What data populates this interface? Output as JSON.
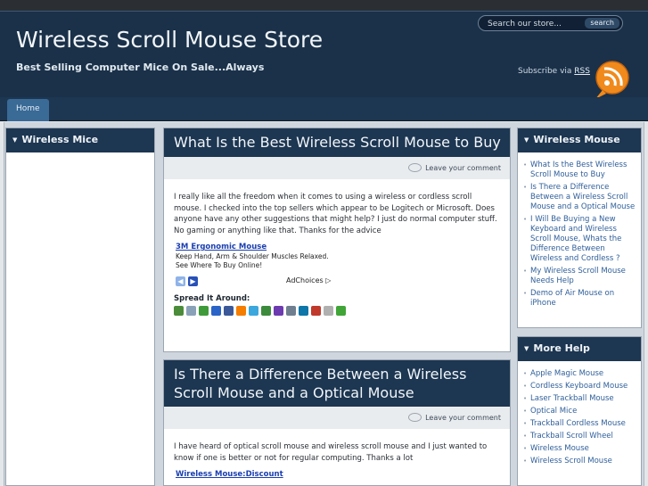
{
  "header": {
    "site_title": "Wireless Scroll Mouse Store",
    "tagline": "Best Selling Computer Mice On Sale...Always",
    "search_placeholder": "Search our store...",
    "search_button": "search",
    "subscribe_text": "Subscribe via",
    "subscribe_link": "RSS",
    "rss_icon": "rss-feed-icon"
  },
  "nav": {
    "items": [
      {
        "label": "Home"
      }
    ]
  },
  "left_sidebar": {
    "title": "Wireless Mice"
  },
  "posts": [
    {
      "title": "What Is the Best Wireless Scroll Mouse to Buy",
      "comment_link": "Leave your comment",
      "body": "I really like all the freedom when it comes to using a wireless or cordless scroll mouse. I checked into the top sellers which appear to be Logitech or Microsoft. Does anyone have any other suggestions that might help? I just do normal computer stuff. No gaming or anything like that. Thanks for the advice",
      "ad": {
        "link": "3M Ergonomic Mouse",
        "line1": "Keep Hand, Arm & Shoulder Muscles Relaxed.",
        "line2": "See Where To Buy Online!",
        "adchoices": "AdChoices ▷"
      },
      "spread_label": "Spread It Around:"
    },
    {
      "title": "Is There a Difference Between a Wireless Scroll Mouse and a Optical Mouse",
      "comment_link": "Leave your comment",
      "body": "I have heard of optical scroll mouse and wireless scroll mouse and I just wanted to know if one is better or not for regular computing. Thanks a lot",
      "ad": {
        "link": "Wireless Mouse:Discount"
      }
    }
  ],
  "right_sidebar": {
    "widgets": [
      {
        "title": "Wireless Mouse",
        "items": [
          "What Is the Best Wireless Scroll Mouse to Buy",
          "Is There a Difference Between a Wireless Scroll Mouse and a Optical Mouse",
          "I Will Be Buying a New Keyboard and Wireless Scroll Mouse, Whats the Difference Between Wireless and Cordless ?",
          "My Wireless Scroll Mouse Needs Help",
          "Demo of Air Mouse on iPhone"
        ]
      },
      {
        "title": "More Help",
        "items": [
          "Apple Magic Mouse",
          "Cordless Keyboard Mouse",
          "Laser Trackball Mouse",
          "Optical Mice",
          "Trackball Cordless Mouse",
          "Trackball Scroll Wheel",
          "Wireless Mouse",
          "Wireless Scroll Mouse"
        ]
      }
    ]
  },
  "share_icons": [
    {
      "name": "print-icon",
      "color": "#4b8c3a"
    },
    {
      "name": "digg-icon",
      "color": "#8aa2b8"
    },
    {
      "name": "stumbleupon-icon",
      "color": "#3f9b3a"
    },
    {
      "name": "delicious-icon",
      "color": "#2a64c8"
    },
    {
      "name": "facebook-icon",
      "color": "#3b5998"
    },
    {
      "name": "blogger-icon",
      "color": "#f57d00"
    },
    {
      "name": "twitter-icon",
      "color": "#3ba7dd"
    },
    {
      "name": "google-icon",
      "color": "#3c8b3c"
    },
    {
      "name": "yahoo-icon",
      "color": "#6d3bb0"
    },
    {
      "name": "email-icon",
      "color": "#6f7f90"
    },
    {
      "name": "linkedin-icon",
      "color": "#0e76a8"
    },
    {
      "name": "myspace-icon",
      "color": "#c0392b"
    },
    {
      "name": "reddit-icon",
      "color": "#b0b0b0"
    },
    {
      "name": "technorati-icon",
      "color": "#40a536"
    }
  ],
  "colors": {
    "header_bg": "#1a3149",
    "accent_tab": "#3a6a96",
    "link": "#2f5f9a"
  }
}
